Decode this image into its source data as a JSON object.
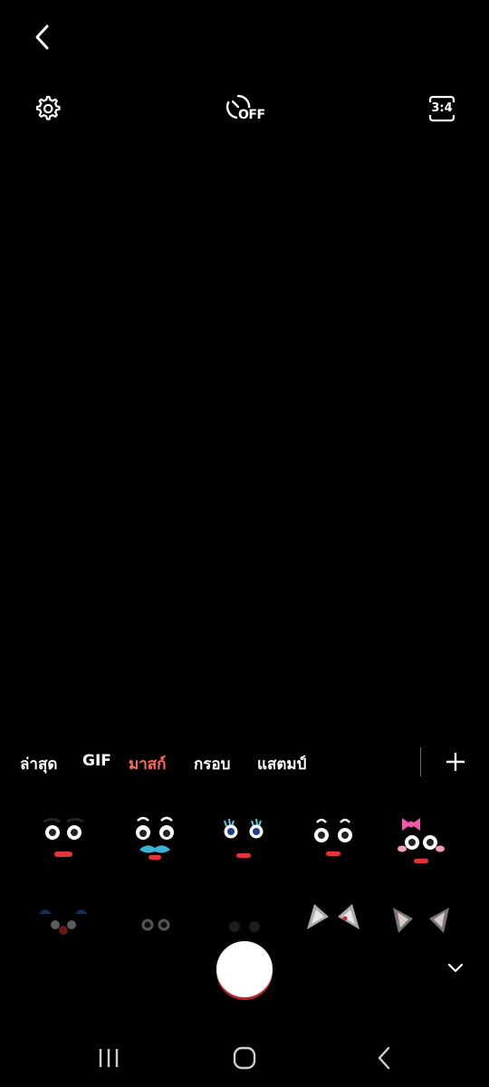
{
  "top_bar": {
    "back_icon": "chevron-left-icon",
    "settings_icon": "gear-icon",
    "timer_label": "OFF",
    "ratio_label": "3:4"
  },
  "effects_tabs": [
    {
      "label": "ล่าสุด",
      "active": false
    },
    {
      "label": "GIF",
      "active": false
    },
    {
      "label": "มาสก์",
      "active": true
    },
    {
      "label": "กรอบ",
      "active": false
    },
    {
      "label": "แสตมป์",
      "active": false
    }
  ],
  "colors": {
    "active_tab": "#ff6a5a",
    "background": "#000000",
    "shutter_ring": "#b5262a"
  },
  "stickers_row1": [
    "face-mask-1",
    "face-mask-2",
    "face-mask-3",
    "face-mask-4",
    "face-mask-5"
  ],
  "stickers_row2": [
    "face-mask-6",
    "face-mask-7",
    "face-mask-8",
    "face-mask-9",
    "face-mask-10"
  ],
  "nav_bar": [
    "recent-apps-icon",
    "home-icon",
    "back-icon"
  ]
}
